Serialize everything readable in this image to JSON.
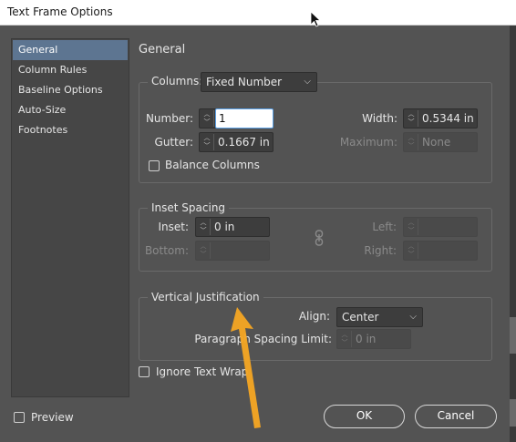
{
  "window": {
    "title": "Text Frame Options"
  },
  "sidebar": {
    "items": [
      {
        "label": "General",
        "active": true
      },
      {
        "label": "Column Rules",
        "active": false
      },
      {
        "label": "Baseline Options",
        "active": false
      },
      {
        "label": "Auto-Size",
        "active": false
      },
      {
        "label": "Footnotes",
        "active": false
      }
    ]
  },
  "main": {
    "heading": "General"
  },
  "columns": {
    "label": "Columns:",
    "type_value": "Fixed Number",
    "number_label": "Number:",
    "number_value": "1",
    "gutter_label": "Gutter:",
    "gutter_value": "0.1667 in",
    "width_label": "Width:",
    "width_value": "0.5344 in",
    "maximum_label": "Maximum:",
    "maximum_value": "None",
    "balance_label": "Balance Columns",
    "balance_checked": false
  },
  "inset": {
    "title": "Inset Spacing",
    "inset_label": "Inset:",
    "inset_value": "0 in",
    "bottom_label": "Bottom:",
    "left_label": "Left:",
    "right_label": "Right:",
    "link_icon": "chain-link-icon"
  },
  "vertical": {
    "title": "Vertical Justification",
    "align_label": "Align:",
    "align_value": "Center",
    "paragraph_label": "Paragraph Spacing Limit:",
    "paragraph_value": "0 in"
  },
  "ignore_wrap": {
    "label": "Ignore Text Wrap",
    "checked": false
  },
  "preview": {
    "label": "Preview",
    "checked": false
  },
  "buttons": {
    "ok": "OK",
    "cancel": "Cancel"
  },
  "annotation": {
    "arrow_color": "#f5a623"
  },
  "colors": {
    "accent": "#5d7591",
    "background": "#535353"
  }
}
